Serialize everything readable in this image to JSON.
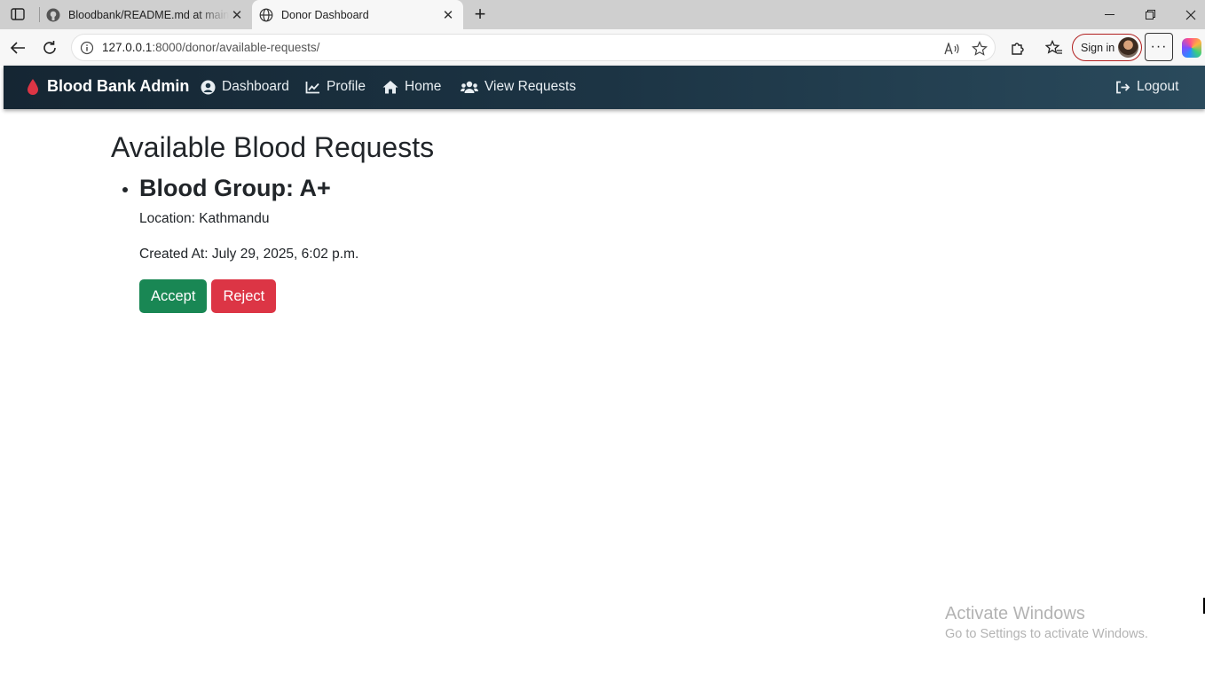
{
  "browser": {
    "tabs": [
      {
        "title": "Bloodbank/README.md at main · ",
        "icon": "github-icon",
        "active": false
      },
      {
        "title": "Donor Dashboard",
        "icon": "globe-icon",
        "active": true
      }
    ],
    "url": {
      "host": "127.0.0.1",
      "path": ":8000/donor/available-requests/"
    },
    "sign_in_label": "Sign in",
    "more_label": "···"
  },
  "navbar": {
    "brand": "Blood Bank Admin",
    "links": [
      {
        "label": "Dashboard",
        "icon": "user-circle-icon"
      },
      {
        "label": "Profile",
        "icon": "line-chart-icon"
      },
      {
        "label": "Home",
        "icon": "home-icon"
      },
      {
        "label": "View Requests",
        "icon": "users-icon"
      }
    ],
    "logout": "Logout",
    "colors": {
      "brand_drop": "#dc3545",
      "bar": "#1c3444"
    }
  },
  "main": {
    "heading": "Available Blood Requests",
    "requests": [
      {
        "blood_group": "Blood Group: A+",
        "location": "Location: Kathmandu",
        "created_at": "Created At: July 29, 2025, 6:02 p.m.",
        "accept_label": "Accept",
        "reject_label": "Reject"
      }
    ],
    "colors": {
      "accept": "#198754",
      "reject": "#dc3545"
    }
  },
  "watermark": {
    "line1": "Activate Windows",
    "line2": "Go to Settings to activate Windows."
  }
}
